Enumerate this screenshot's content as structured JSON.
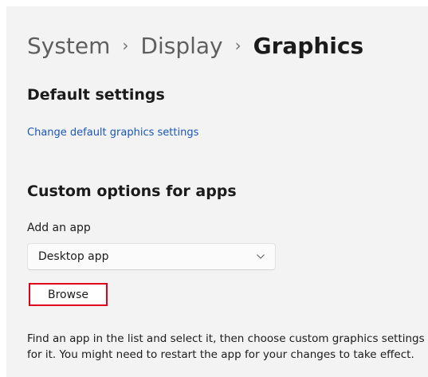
{
  "breadcrumb": {
    "items": [
      "System",
      "Display"
    ],
    "separator": "›",
    "current": "Graphics"
  },
  "default_settings": {
    "title": "Default settings",
    "link_label": "Change default graphics settings"
  },
  "custom_options": {
    "title": "Custom options for apps",
    "add_app_label": "Add an app",
    "app_type_selected": "Desktop app",
    "browse_label": "Browse",
    "description": "Find an app in the list and select it, then choose custom graphics settings for it. You might need to restart the app for your changes to take effect."
  },
  "icons": {
    "dropdown": "chevron-down-icon"
  },
  "colors": {
    "link": "#1a56b8",
    "highlight": "#e0001b",
    "background": "#f3f3f3"
  }
}
